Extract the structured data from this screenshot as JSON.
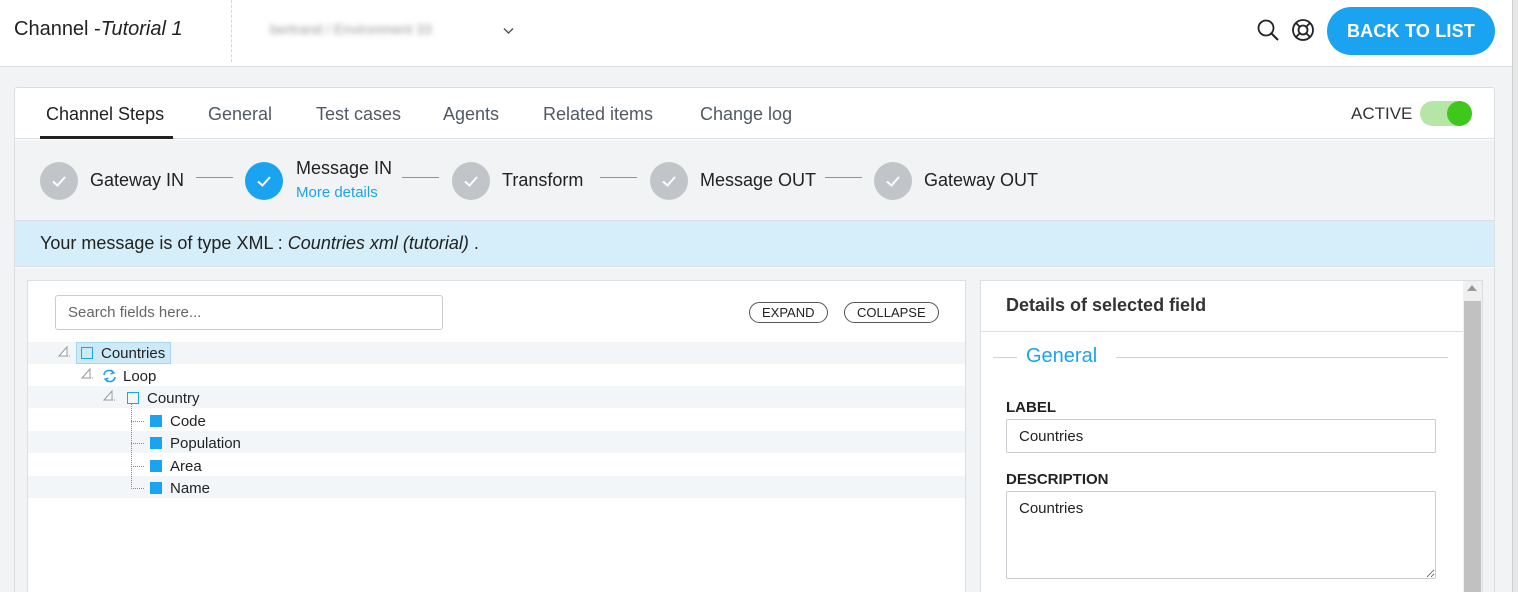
{
  "header": {
    "title_prefix": "Channel -",
    "title_name": "Tutorial 1",
    "environment": "bertrand / Environment 33",
    "back_label": "BACK TO LIST",
    "search_icon": "search-icon",
    "help_icon": "lifebuoy-icon"
  },
  "tabs": {
    "items": [
      {
        "label": "Channel Steps",
        "active": true
      },
      {
        "label": "General"
      },
      {
        "label": "Test cases"
      },
      {
        "label": "Agents"
      },
      {
        "label": "Related items"
      },
      {
        "label": "Change log"
      }
    ],
    "active_label": "ACTIVE",
    "active_on": true
  },
  "steps": {
    "items": [
      {
        "label": "Gateway IN",
        "state": "done"
      },
      {
        "label": "Message IN",
        "state": "current",
        "link": "More details"
      },
      {
        "label": "Transform",
        "state": "done"
      },
      {
        "label": "Message OUT",
        "state": "done"
      },
      {
        "label": "Gateway OUT",
        "state": "done"
      }
    ]
  },
  "info": {
    "prefix": "Your message is of type XML : ",
    "type": "Countries xml (tutorial)",
    "suffix": " ."
  },
  "tree": {
    "search_placeholder": "Search fields here...",
    "expand_label": "EXPAND",
    "collapse_label": "COLLAPSE",
    "nodes": [
      {
        "label": "Countries",
        "kind": "element",
        "selected": true
      },
      {
        "label": "Loop",
        "kind": "loop"
      },
      {
        "label": "Country",
        "kind": "element"
      },
      {
        "label": "Code",
        "kind": "field"
      },
      {
        "label": "Population",
        "kind": "field"
      },
      {
        "label": "Area",
        "kind": "field"
      },
      {
        "label": "Name",
        "kind": "field"
      }
    ]
  },
  "details": {
    "title": "Details of selected field",
    "section": "General",
    "label_caption": "LABEL",
    "label_value": "Countries",
    "description_caption": "DESCRIPTION",
    "description_value": "Countries"
  },
  "colors": {
    "accent": "#1aa3f0",
    "toggle_on": "#3fc71b",
    "info_bg": "#d6eef9",
    "step_done": "#c1c5c9"
  }
}
